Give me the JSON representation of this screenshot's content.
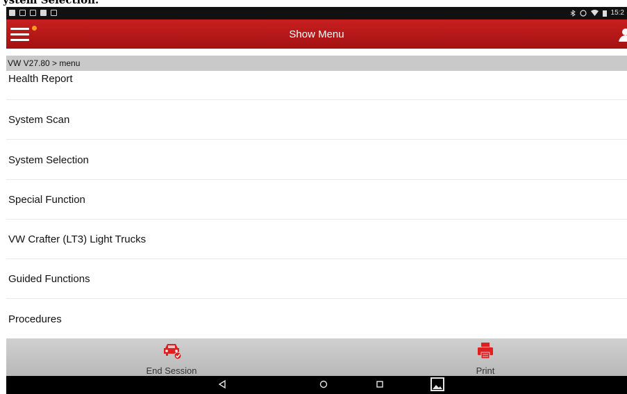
{
  "caption": {
    "text": "ystem Selection."
  },
  "status_bar": {
    "time": "15:2"
  },
  "header": {
    "title": "Show Menu"
  },
  "breadcrumb": {
    "text": "VW V27.80 > menu"
  },
  "menu": {
    "items": [
      {
        "label": "Health Report"
      },
      {
        "label": "System Scan"
      },
      {
        "label": "System Selection"
      },
      {
        "label": "Special Function"
      },
      {
        "label": "VW Crafter (LT3) Light Trucks"
      },
      {
        "label": "Guided Functions"
      },
      {
        "label": "Procedures"
      }
    ]
  },
  "actions": {
    "end_session": {
      "label": "End Session",
      "icon": "car-check-icon"
    },
    "print": {
      "label": "Print",
      "icon": "printer-icon"
    }
  },
  "colors": {
    "header_red": "#b81818",
    "accent_orange": "#ff9a1a",
    "breadcrumb_gray": "#c9c9c9",
    "action_icon_red": "#e02020"
  }
}
